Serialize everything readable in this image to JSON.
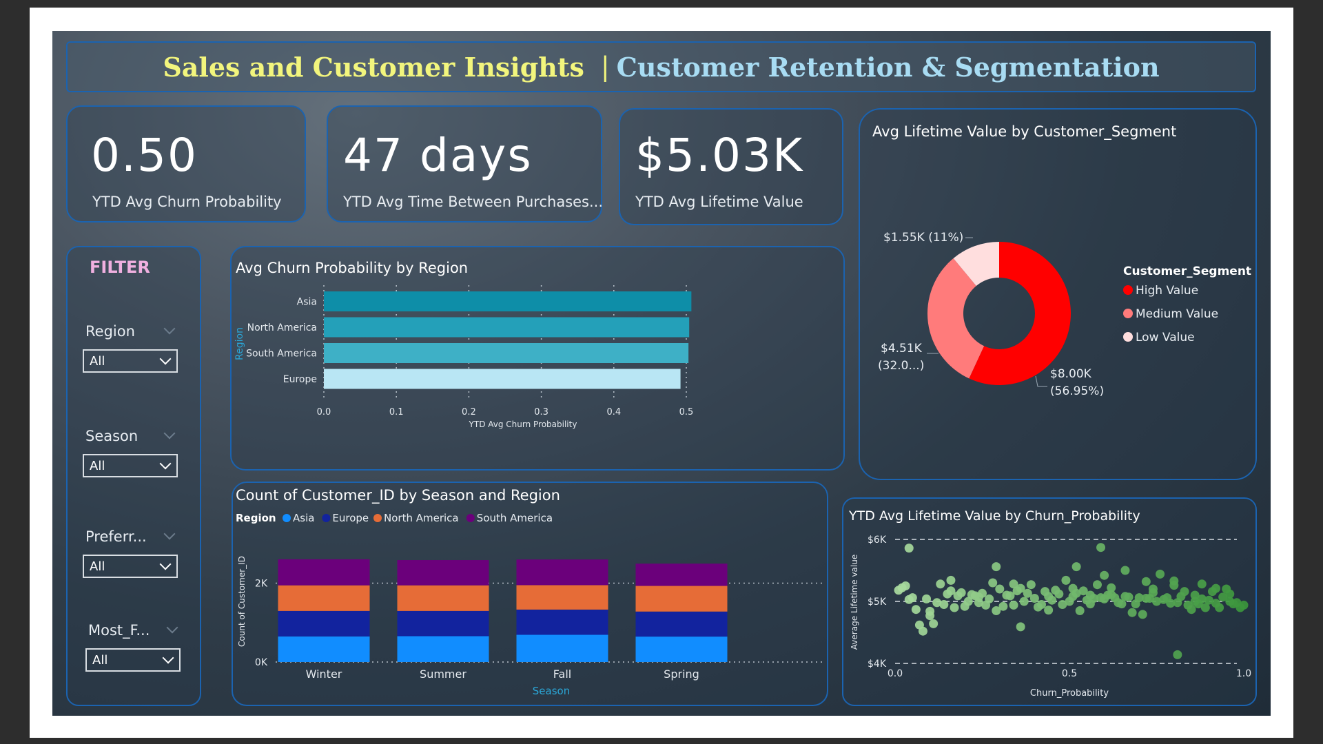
{
  "header": {
    "title_main": "Sales and Customer Insights",
    "title_sep": "|",
    "title_sub": "Customer Retention & Segmentation"
  },
  "kpis": [
    {
      "value": "0.50",
      "label": "YTD Avg Churn Probability"
    },
    {
      "value": "47 days",
      "label": "YTD Avg Time Between Purchases..."
    },
    {
      "value": "$5.03K",
      "label": "YTD Avg Lifetime Value"
    }
  ],
  "filter": {
    "title": "FILTER",
    "slicers": [
      {
        "label": "Region",
        "value": "All"
      },
      {
        "label": "Season",
        "value": "All"
      },
      {
        "label": "Preferr...",
        "value": "All"
      },
      {
        "label": "Most_F...",
        "value": "All"
      }
    ]
  },
  "colors": {
    "title_yellow": "#f2f57d",
    "title_blue": "#a8dcf3",
    "card_border": "#1b63b0",
    "filter_pink": "#f0b0e0"
  },
  "chart_data": [
    {
      "id": "churn_by_region",
      "type": "bar",
      "orientation": "horizontal",
      "title": "Avg Churn Probability by Region",
      "xlabel": "YTD Avg Churn Probability",
      "ylabel": "Region",
      "categories": [
        "Asia",
        "North America",
        "South America",
        "Europe"
      ],
      "values": [
        0.507,
        0.504,
        0.503,
        0.492
      ],
      "bar_colors": [
        "#0e8ea8",
        "#24a0b9",
        "#3eb0c6",
        "#b9e6f4"
      ],
      "xlim": [
        0,
        0.5
      ],
      "xticks": [
        "0.0",
        "0.1",
        "0.2",
        "0.3",
        "0.4",
        "0.5"
      ]
    },
    {
      "id": "segment_donut",
      "type": "pie",
      "donut": true,
      "title": "Avg Lifetime Value by Customer_Segment",
      "legend_title": "Customer_Segment",
      "legend_position": "right",
      "slices": [
        {
          "name": "High Value",
          "value": 8.0,
          "percent": 56.95,
          "label": "$8.00K (56.95%)",
          "color": "#ff0000"
        },
        {
          "name": "Medium Value",
          "value": 4.51,
          "percent": 32.0,
          "label": "$4.51K (32.0...)",
          "color": "#ff7b7b"
        },
        {
          "name": "Low Value",
          "value": 1.55,
          "percent": 11,
          "label": "$1.55K (11%)",
          "color": "#ffdede"
        }
      ],
      "data_labels": {
        "high_1": "$8.00K",
        "high_2": "(56.95%)",
        "med_1": "$4.51K",
        "med_2": "(32.0...)",
        "low": "$1.55K (11%)"
      }
    },
    {
      "id": "customers_by_season_region",
      "type": "bar",
      "stacked": true,
      "title": "Count of Customer_ID by Season and Region",
      "legend_title": "Region",
      "legend_position": "top-left",
      "xlabel": "Season",
      "ylabel": "Count of Customer_ID",
      "categories": [
        "Winter",
        "Summer",
        "Fall",
        "Spring"
      ],
      "series": [
        {
          "name": "Asia",
          "color": "#118dff",
          "values": [
            650,
            655,
            690,
            645
          ]
        },
        {
          "name": "Europe",
          "color": "#12239e",
          "values": [
            645,
            640,
            640,
            635
          ]
        },
        {
          "name": "North America",
          "color": "#e66c37",
          "values": [
            650,
            650,
            620,
            650
          ]
        },
        {
          "name": "South America",
          "color": "#6b007b",
          "values": [
            660,
            640,
            650,
            565
          ]
        }
      ],
      "ylim": [
        0,
        2900
      ],
      "yticks": [
        {
          "v": 0,
          "t": "0K"
        },
        {
          "v": 2000,
          "t": "2K"
        }
      ]
    },
    {
      "id": "ltv_by_churn",
      "type": "scatter",
      "title": "YTD Avg Lifetime Value by Churn_Probability",
      "xlabel": "Churn_Probability",
      "ylabel": "Average Lifetime value",
      "xlim": [
        0,
        1
      ],
      "ylim": [
        4000,
        6000
      ],
      "xticks": [
        "0.0",
        "0.5",
        "1.0"
      ],
      "yticks": [
        "$4K",
        "$5K",
        "$6K"
      ],
      "points": [
        [
          0.01,
          5180
        ],
        [
          0.02,
          5220
        ],
        [
          0.03,
          5250
        ],
        [
          0.04,
          5030
        ],
        [
          0.05,
          5060
        ],
        [
          0.06,
          4870
        ],
        [
          0.07,
          4620
        ],
        [
          0.08,
          4520
        ],
        [
          0.09,
          5040
        ],
        [
          0.1,
          4840
        ],
        [
          0.11,
          4640
        ],
        [
          0.12,
          4980
        ],
        [
          0.13,
          5280
        ],
        [
          0.14,
          4950
        ],
        [
          0.15,
          5120
        ],
        [
          0.16,
          5170
        ],
        [
          0.17,
          4900
        ],
        [
          0.18,
          5090
        ],
        [
          0.19,
          5140
        ],
        [
          0.2,
          4920
        ],
        [
          0.21,
          5000
        ],
        [
          0.22,
          5110
        ],
        [
          0.23,
          5090
        ],
        [
          0.24,
          5070
        ],
        [
          0.25,
          5130
        ],
        [
          0.26,
          4940
        ],
        [
          0.27,
          5040
        ],
        [
          0.28,
          5300
        ],
        [
          0.29,
          4850
        ],
        [
          0.3,
          5200
        ],
        [
          0.31,
          4920
        ],
        [
          0.32,
          5100
        ],
        [
          0.33,
          5090
        ],
        [
          0.34,
          4940
        ],
        [
          0.35,
          5170
        ],
        [
          0.36,
          5210
        ],
        [
          0.37,
          5000
        ],
        [
          0.38,
          5130
        ],
        [
          0.39,
          5270
        ],
        [
          0.4,
          5050
        ],
        [
          0.41,
          4910
        ],
        [
          0.42,
          4950
        ],
        [
          0.43,
          5160
        ],
        [
          0.44,
          5080
        ],
        [
          0.45,
          5020
        ],
        [
          0.46,
          5180
        ],
        [
          0.47,
          5120
        ],
        [
          0.48,
          4950
        ],
        [
          0.49,
          5340
        ],
        [
          0.5,
          5000
        ],
        [
          0.51,
          5080
        ],
        [
          0.52,
          5130
        ],
        [
          0.53,
          4850
        ],
        [
          0.54,
          5170
        ],
        [
          0.55,
          5020
        ],
        [
          0.56,
          5100
        ],
        [
          0.57,
          5050
        ],
        [
          0.58,
          5270
        ],
        [
          0.59,
          5060
        ],
        [
          0.6,
          5040
        ],
        [
          0.61,
          5100
        ],
        [
          0.62,
          5110
        ],
        [
          0.63,
          5060
        ],
        [
          0.64,
          4980
        ],
        [
          0.65,
          4960
        ],
        [
          0.66,
          5080
        ],
        [
          0.67,
          5070
        ],
        [
          0.68,
          4820
        ],
        [
          0.69,
          4960
        ],
        [
          0.7,
          5060
        ],
        [
          0.71,
          4790
        ],
        [
          0.72,
          5320
        ],
        [
          0.73,
          5050
        ],
        [
          0.74,
          5140
        ],
        [
          0.75,
          5000
        ],
        [
          0.76,
          5440
        ],
        [
          0.77,
          5030
        ],
        [
          0.78,
          5060
        ],
        [
          0.79,
          4970
        ],
        [
          0.8,
          5260
        ],
        [
          0.81,
          4980
        ],
        [
          0.82,
          5080
        ],
        [
          0.83,
          5160
        ],
        [
          0.84,
          4940
        ],
        [
          0.85,
          4870
        ],
        [
          0.86,
          5000
        ],
        [
          0.87,
          4960
        ],
        [
          0.88,
          5040
        ],
        [
          0.89,
          4900
        ],
        [
          0.9,
          5020
        ],
        [
          0.91,
          5160
        ],
        [
          0.92,
          4970
        ],
        [
          0.93,
          4900
        ],
        [
          0.94,
          5070
        ],
        [
          0.95,
          5200
        ],
        [
          0.96,
          5120
        ],
        [
          0.97,
          4960
        ],
        [
          0.98,
          4980
        ],
        [
          0.99,
          4900
        ],
        [
          1.0,
          4940
        ],
        [
          0.04,
          5860
        ],
        [
          0.16,
          5340
        ],
        [
          0.34,
          5280
        ],
        [
          0.52,
          5560
        ],
        [
          0.6,
          5420
        ],
        [
          0.8,
          5330
        ],
        [
          0.92,
          5210
        ],
        [
          0.66,
          5500
        ],
        [
          0.1,
          4770
        ],
        [
          0.24,
          4980
        ],
        [
          0.44,
          4860
        ],
        [
          0.56,
          4960
        ],
        [
          0.74,
          5200
        ],
        [
          0.86,
          5100
        ],
        [
          0.96,
          5000
        ],
        [
          0.29,
          5560
        ],
        [
          0.51,
          5210
        ],
        [
          0.62,
          5220
        ],
        [
          0.72,
          5050
        ],
        [
          0.88,
          5280
        ],
        [
          0.36,
          4590
        ],
        [
          0.81,
          4140
        ],
        [
          0.59,
          5870
        ]
      ]
    }
  ]
}
